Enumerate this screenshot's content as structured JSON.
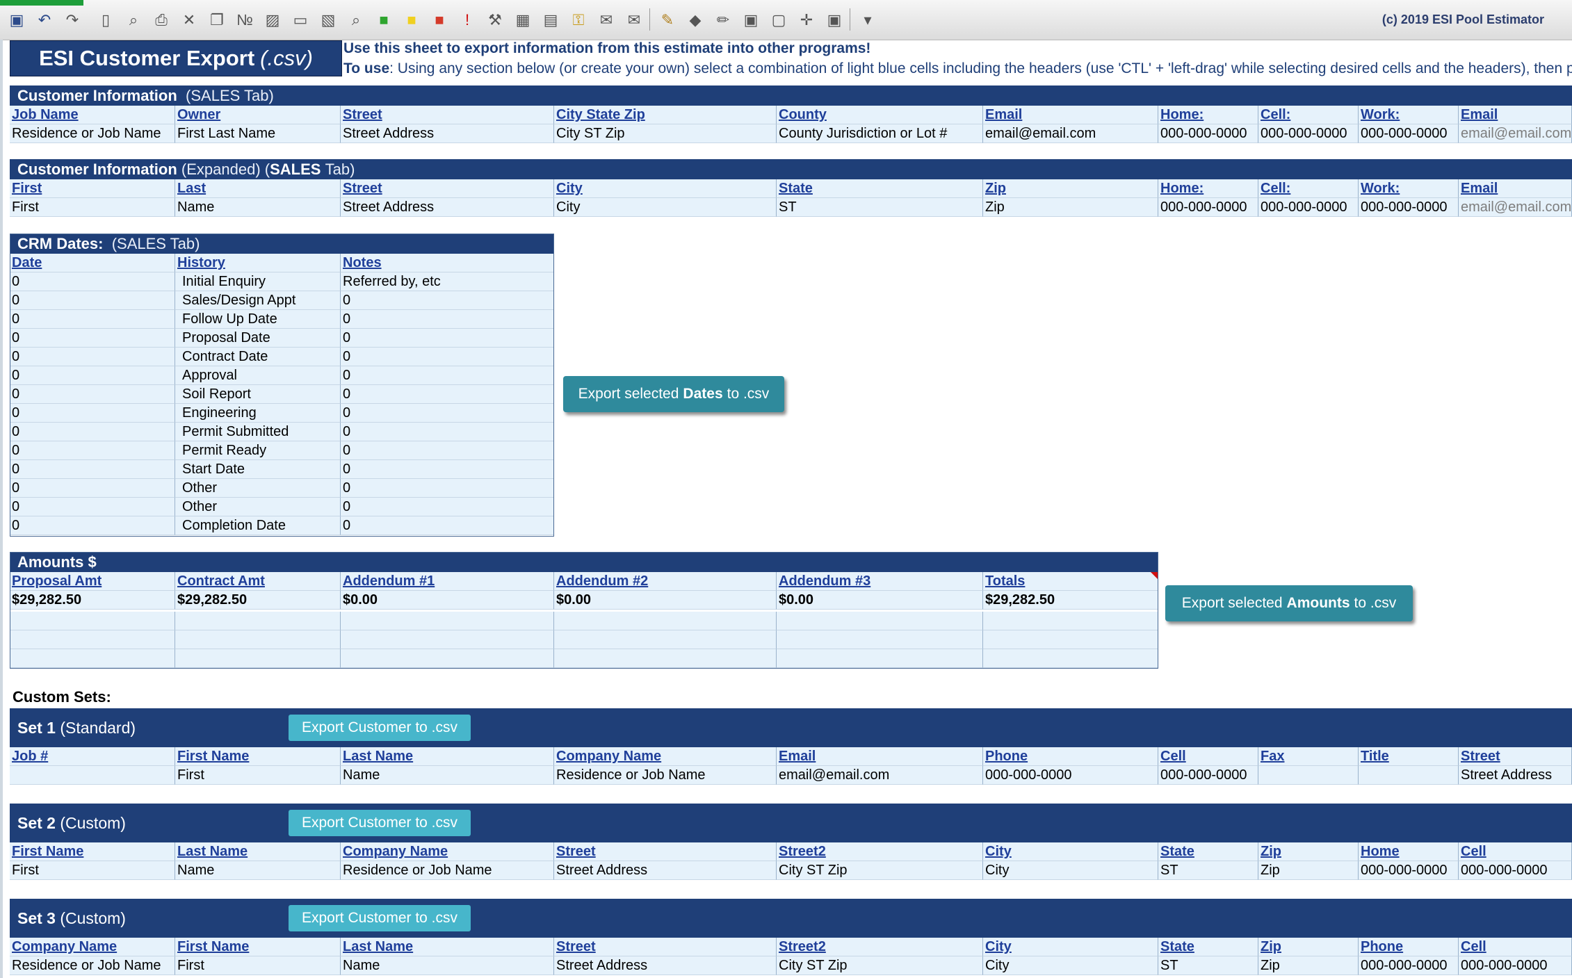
{
  "toolbar": {
    "icons": [
      "save-icon",
      "undo-icon",
      "redo-icon",
      "new-page-icon",
      "print-preview-icon",
      "print-icon",
      "close-icon",
      "copy-icon",
      "numbering-icon",
      "image-icon",
      "folder-icon",
      "picture-icon",
      "zoom-icon",
      "green-fill-icon",
      "yellow-fill-icon",
      "red-fill-icon",
      "exclamation-icon",
      "tools-icon",
      "calendar-icon",
      "gallery-icon",
      "key-icon",
      "mail-icon",
      "mail-send-icon",
      "brush-icon",
      "paint-bucket-icon",
      "edit-icon",
      "group-icon",
      "ungroup-icon",
      "position-icon",
      "arrange-icon",
      "overflow-icon"
    ],
    "copyright": "(c) 2019 ESI Pool Estimator"
  },
  "title": {
    "main": "ESI Customer Export",
    "ext": "(.csv)"
  },
  "instructions": {
    "line1": "Use this sheet to export information from this estimate into other programs!",
    "line2_label": "To use",
    "line2": ": Using any section below (or create your own) select a combination of light blue cells including the headers (use 'CTL' + 'left-drag' while selecting desired cells and the headers), then p"
  },
  "customer_info": {
    "title_bold": "Customer Information",
    "title_light": "(SALES Tab)",
    "headers": [
      "Job Name",
      "Owner",
      "Street",
      "City State Zip",
      "County",
      "Email",
      "Home:",
      "Cell:",
      "Work:",
      "Email"
    ],
    "values": [
      "Residence or Job Name",
      "First Last Name",
      "Street Address",
      "City ST Zip",
      "County Jurisdiction or Lot #",
      "email@email.com",
      "000-000-0000",
      "000-000-0000",
      "000-000-0000",
      "email@email.com"
    ]
  },
  "customer_expanded": {
    "title_bold": "Customer Information",
    "title_mid": "(Expanded) (",
    "title_bold2": "SALES",
    "title_end": "Tab)",
    "headers": [
      "First",
      "Last",
      "Street",
      "City",
      "State",
      "Zip",
      "Home:",
      "Cell:",
      "Work:",
      "Email"
    ],
    "values": [
      "First",
      "Name",
      "Street Address",
      "City",
      "ST",
      "Zip",
      "000-000-0000",
      "000-000-0000",
      "000-000-0000",
      "email@email.com"
    ]
  },
  "crm": {
    "title_bold": "CRM  Dates:",
    "title_light": "(SALES Tab)",
    "headers": [
      "Date",
      "History",
      "Notes"
    ],
    "rows": [
      [
        "0",
        "Initial Enquiry",
        "Referred by, etc"
      ],
      [
        "0",
        "Sales/Design Appt",
        "0"
      ],
      [
        "0",
        "Follow Up Date",
        "0"
      ],
      [
        "0",
        "Proposal Date",
        "0"
      ],
      [
        "0",
        "Contract Date",
        "0"
      ],
      [
        "0",
        "Approval",
        "0"
      ],
      [
        "0",
        "Soil Report",
        "0"
      ],
      [
        "0",
        "Engineering",
        "0"
      ],
      [
        "0",
        "Permit Submitted",
        "0"
      ],
      [
        "0",
        "Permit Ready",
        "0"
      ],
      [
        "0",
        "Start Date",
        "0"
      ],
      [
        "0",
        "Other",
        "0"
      ],
      [
        "0",
        "Other",
        "0"
      ],
      [
        "0",
        "Completion Date",
        "0"
      ]
    ],
    "export_button": {
      "pre": "Export selected",
      "bold": "Dates",
      "post": "to .csv"
    }
  },
  "amounts": {
    "title": "Amounts $",
    "headers": [
      "Proposal Amt",
      "Contract Amt",
      "Addendum #1",
      "Addendum #2",
      "Addendum #3",
      "Totals"
    ],
    "values": [
      "$29,282.50",
      "$29,282.50",
      "$0.00",
      "$0.00",
      "$0.00",
      "$29,282.50"
    ],
    "export_button": {
      "pre": "Export selected",
      "bold": "Amounts",
      "post": "to .csv"
    }
  },
  "custom_sets": {
    "label": "Custom Sets:",
    "sets": [
      {
        "title_bold": "Set 1",
        "title_rest": "(Standard)",
        "button": "Export Customer to .csv",
        "headers": [
          "Job #",
          "First Name",
          "Last Name",
          "Company Name",
          "Email",
          "Phone",
          "Cell",
          "Fax",
          "Title",
          "Street"
        ],
        "values": [
          "",
          "First",
          "Name",
          "Residence or Job Name",
          "email@email.com",
          "000-000-0000",
          "000-000-0000",
          "",
          "",
          "Street Address"
        ]
      },
      {
        "title_bold": "Set 2",
        "title_rest": "(Custom)",
        "button": "Export Customer to .csv",
        "headers": [
          "First Name",
          "Last Name",
          "Company Name",
          "Street",
          "Street2",
          "City",
          "State",
          "Zip",
          "Home",
          "Cell"
        ],
        "values": [
          "First",
          "Name",
          "Residence or Job Name",
          "Street Address",
          "City ST Zip",
          "City",
          "ST",
          "Zip",
          "000-000-0000",
          "000-000-0000"
        ]
      },
      {
        "title_bold": "Set 3",
        "title_rest": "(Custom)",
        "button": "Export Customer to .csv",
        "headers": [
          "Company Name",
          "First Name",
          "Last Name",
          "Street",
          "Street2",
          "City",
          "State",
          "Zip",
          "Phone",
          "Cell"
        ],
        "values": [
          "Residence or Job Name",
          "First",
          "Name",
          "Street Address",
          "City ST Zip",
          "City",
          "ST",
          "Zip",
          "000-000-0000",
          "000-000-0000"
        ]
      }
    ]
  }
}
